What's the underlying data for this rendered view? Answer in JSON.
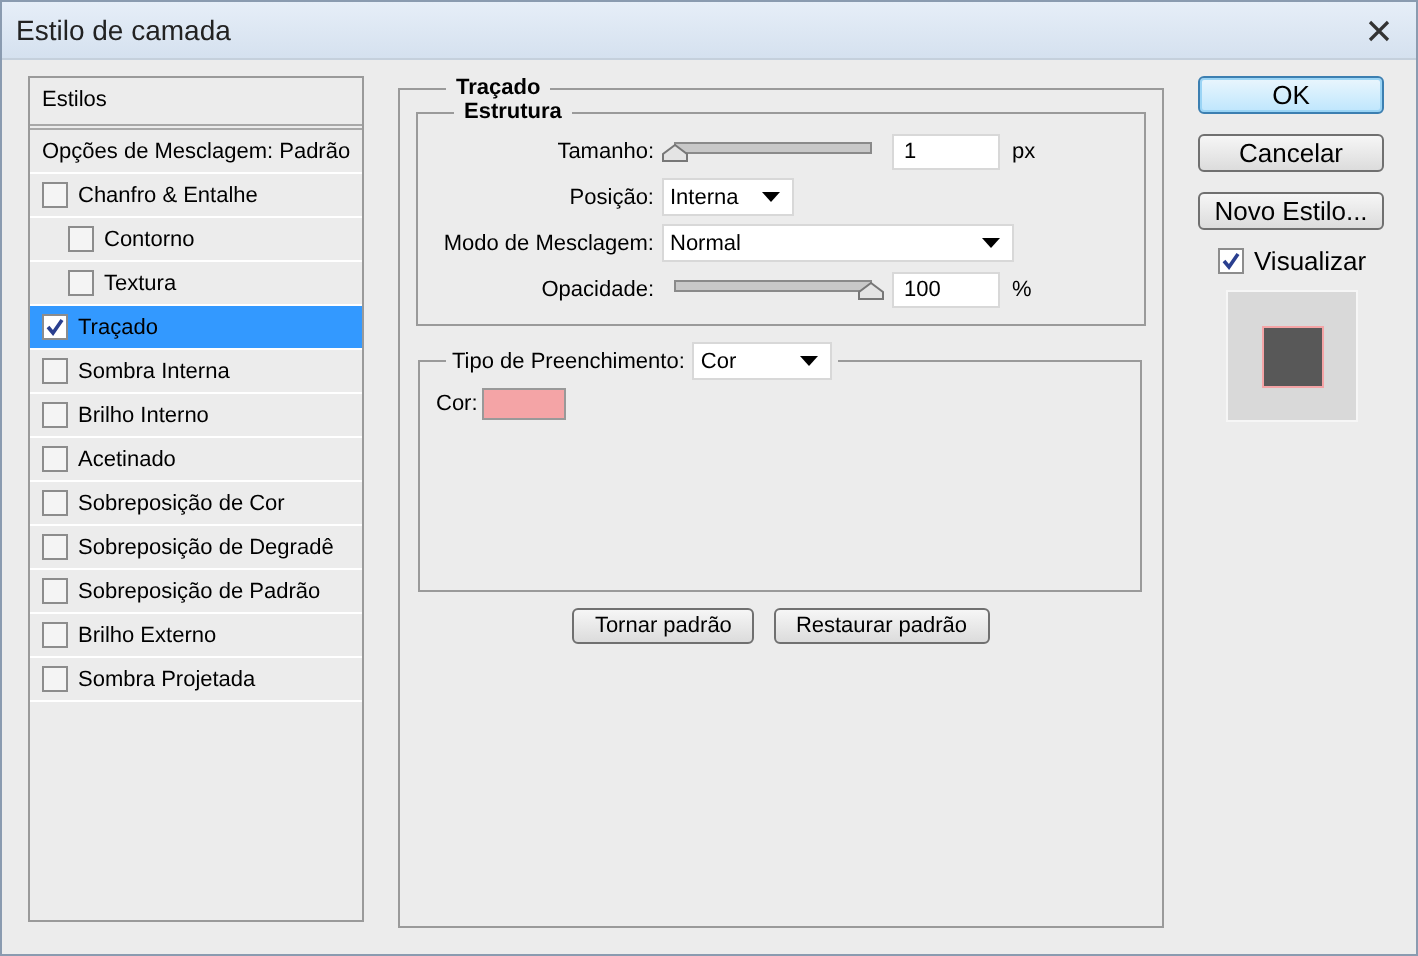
{
  "window": {
    "title": "Estilo de camada"
  },
  "styles_panel": {
    "header": "Estilos",
    "blending_options": "Opções de Mesclagem: Padrão",
    "items": [
      {
        "label": "Chanfro & Entalhe",
        "checked": false,
        "selected": false,
        "children": [
          {
            "label": "Contorno",
            "checked": false,
            "selected": false
          },
          {
            "label": "Textura",
            "checked": false,
            "selected": false
          }
        ]
      },
      {
        "label": "Traçado",
        "checked": true,
        "selected": true
      },
      {
        "label": "Sombra Interna",
        "checked": false,
        "selected": false
      },
      {
        "label": "Brilho Interno",
        "checked": false,
        "selected": false
      },
      {
        "label": "Acetinado",
        "checked": false,
        "selected": false
      },
      {
        "label": "Sobreposição de Cor",
        "checked": false,
        "selected": false
      },
      {
        "label": "Sobreposição de Degradê",
        "checked": false,
        "selected": false
      },
      {
        "label": "Sobreposição de Padrão",
        "checked": false,
        "selected": false
      },
      {
        "label": "Brilho Externo",
        "checked": false,
        "selected": false
      },
      {
        "label": "Sombra Projetada",
        "checked": false,
        "selected": false
      }
    ]
  },
  "stroke": {
    "title": "Traçado",
    "structure": {
      "title": "Estrutura",
      "size": {
        "label": "Tamanho:",
        "level": 0,
        "value": "1",
        "unit": "px"
      },
      "position": {
        "label": "Posição:",
        "value": "Interna"
      },
      "blend_mode": {
        "label": "Modo de Mesclagem:",
        "value": "Normal"
      },
      "opacity": {
        "label": "Opacidade:",
        "level": 1,
        "value": "100",
        "unit": "%"
      }
    },
    "fill": {
      "label": "Tipo de Preenchimento:",
      "value": "Cor",
      "color_label": "Cor:",
      "color": "#f4a4a6"
    },
    "buttons": [
      "Tornar padrão",
      "Restaurar padrão"
    ]
  },
  "side": {
    "buttons": [
      {
        "label": "OK",
        "default": true
      },
      {
        "label": "Cancelar",
        "default": false
      },
      {
        "label": "Novo Estilo...",
        "default": false
      }
    ],
    "preview": {
      "label": "Visualizar",
      "checked": true
    }
  }
}
